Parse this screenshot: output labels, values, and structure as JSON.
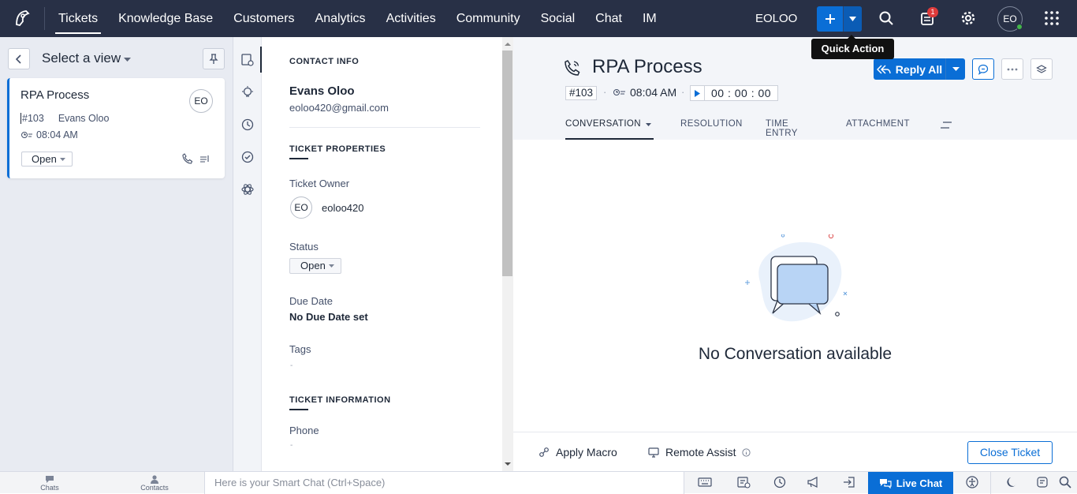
{
  "topbar": {
    "nav": [
      "Tickets",
      "Knowledge Base",
      "Customers",
      "Analytics",
      "Activities",
      "Community",
      "Social",
      "Chat",
      "IM"
    ],
    "active_nav": "Tickets",
    "org_name": "EOLOO",
    "notification_count": "1",
    "user_initials": "EO",
    "tooltip": "Quick Action"
  },
  "left_panel": {
    "view_title": "Select a view",
    "ticket_card": {
      "title": "RPA Process",
      "id": "#103",
      "contact": "Evans Oloo",
      "time": "08:04 AM",
      "status": "Open",
      "avatar": "EO"
    }
  },
  "properties": {
    "contact_info_title": "CONTACT INFO",
    "contact_name": "Evans Oloo",
    "contact_email": "eoloo420@gmail.com",
    "ticket_properties_title": "TICKET PROPERTIES",
    "owner_label": "Ticket Owner",
    "owner_initials": "EO",
    "owner_name": "eoloo420",
    "status_label": "Status",
    "status_value": "Open",
    "due_label": "Due Date",
    "due_value": "No Due Date set",
    "tags_label": "Tags",
    "tags_value": "-",
    "ticket_info_title": "TICKET INFORMATION",
    "phone_label": "Phone",
    "phone_value": "-"
  },
  "ticket": {
    "title": "RPA Process",
    "id": "#103",
    "time": "08:04 AM",
    "timer": "00 : 00 : 00",
    "reply_label": "Reply All",
    "tabs": [
      "CONVERSATION",
      "RESOLUTION",
      "TIME ENTRY",
      "ATTACHMENT"
    ],
    "active_tab": "CONVERSATION",
    "empty_message": "No Conversation available",
    "apply_macro": "Apply Macro",
    "remote_assist": "Remote Assist",
    "close_ticket": "Close Ticket"
  },
  "bottom_bar": {
    "chats": "Chats",
    "contacts": "Contacts",
    "smart_chat_placeholder": "Here is your Smart Chat (Ctrl+Space)",
    "live_chat": "Live Chat"
  },
  "colors": {
    "topbar": "#283046",
    "accent": "#0a6ed6",
    "badge": "#de3b3b"
  }
}
